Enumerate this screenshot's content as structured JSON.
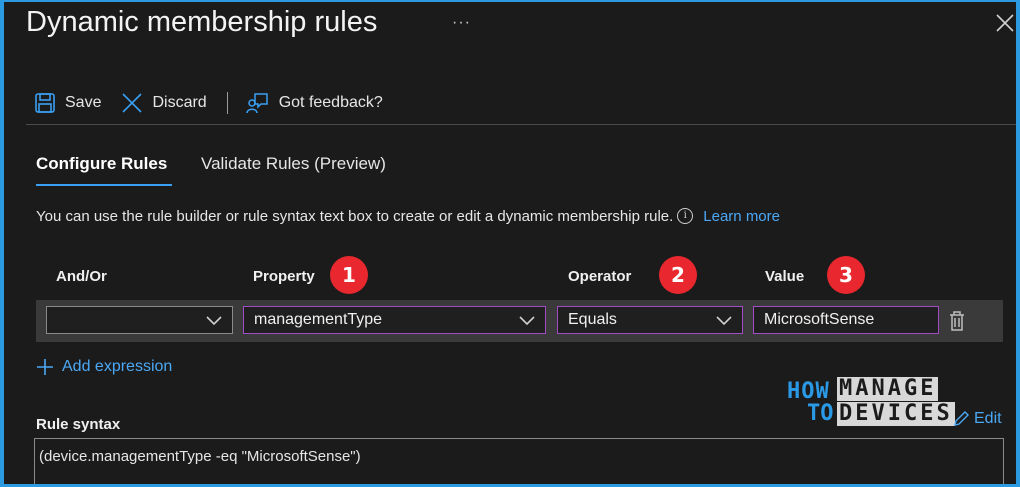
{
  "blade": {
    "title": "Dynamic membership rules",
    "more": "···"
  },
  "toolbar": {
    "save": "Save",
    "discard": "Discard",
    "feedback": "Got feedback?"
  },
  "tabs": [
    {
      "label": "Configure Rules",
      "active": true
    },
    {
      "label": "Validate Rules (Preview)",
      "active": false
    }
  ],
  "description": {
    "text": "You can use the rule builder or rule syntax text box to create or edit a dynamic membership rule.",
    "info_icon": "i",
    "link": "Learn more"
  },
  "columns": {
    "andor": "And/Or",
    "property": "Property",
    "operator": "Operator",
    "value": "Value"
  },
  "badges": [
    "1",
    "2",
    "3"
  ],
  "rule": {
    "andor": "",
    "property": "managementType",
    "operator": "Equals",
    "value": "MicrosoftSense"
  },
  "add_expression": "Add expression",
  "rule_syntax": {
    "label": "Rule syntax",
    "edit": "Edit",
    "text": "(device.managementType -eq \"MicrosoftSense\")"
  },
  "watermark": {
    "line1a": "HOW",
    "line1b": "MANAGE",
    "line2a": "TO",
    "line2b": "DEVICES"
  },
  "colors": {
    "accent": "#3aa0f3",
    "badge": "#e8282e",
    "background": "#1b1b1b",
    "frame": "#2b9ae0",
    "highlight_border": "#a24bc4"
  }
}
